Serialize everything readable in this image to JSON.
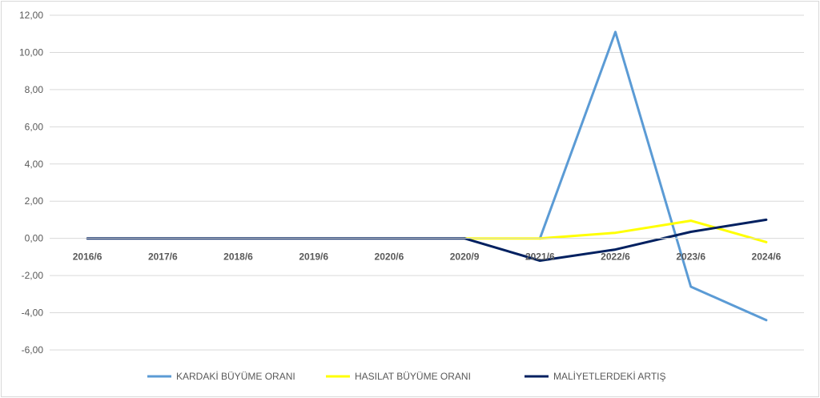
{
  "chart_data": {
    "type": "line",
    "categories": [
      "2016/6",
      "2017/6",
      "2018/6",
      "2019/6",
      "2020/6",
      "2020/9",
      "2021/6",
      "2022/6",
      "2023/6",
      "2024/6"
    ],
    "ylim": [
      -6,
      12
    ],
    "yticks": [
      12,
      10,
      8,
      6,
      4,
      2,
      0,
      -2,
      -4,
      -6
    ],
    "ytick_labels": [
      "12,00",
      "10,00",
      "8,00",
      "6,00",
      "4,00",
      "2,00",
      "0,00",
      "-2,00",
      "-4,00",
      "-6,00"
    ],
    "grid": true,
    "legend_position": "bottom",
    "series": [
      {
        "name": "KARDAKİ BÜYÜME ORANI",
        "color": "#5b9bd5",
        "values": [
          null,
          null,
          null,
          null,
          null,
          null,
          0,
          11.1,
          -2.6,
          -4.4
        ]
      },
      {
        "name": "HASILAT BÜYÜME ORANI",
        "color": "#ffff00",
        "values": [
          null,
          null,
          null,
          null,
          null,
          0,
          0,
          0.3,
          0.95,
          -0.2
        ]
      },
      {
        "name": "MALİYETLERDEKİ ARTIŞ",
        "color": "#002060",
        "values": [
          0,
          0,
          0,
          0,
          0,
          0,
          -1.2,
          -0.6,
          0.35,
          1.0
        ]
      }
    ]
  }
}
